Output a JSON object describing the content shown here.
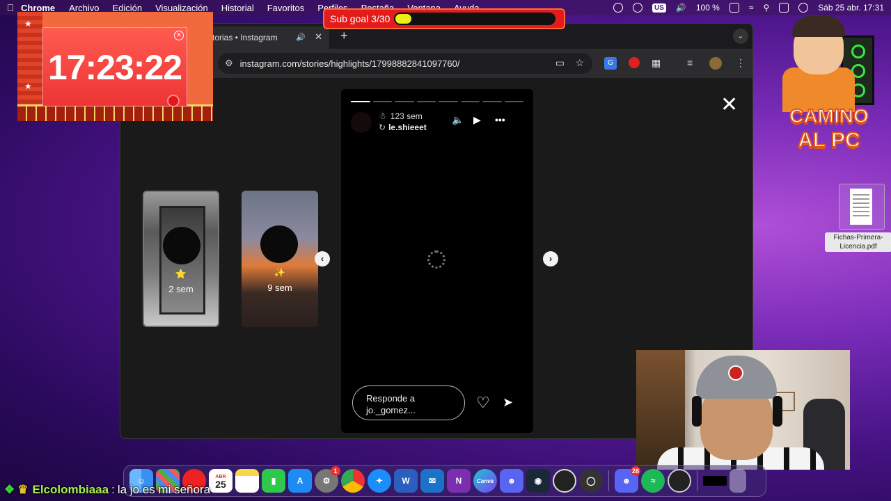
{
  "menubar": {
    "app": "Chrome",
    "items": [
      "Archivo",
      "Edición",
      "Visualización",
      "Historial",
      "Favoritos",
      "Perfiles",
      "Pestaña",
      "Ventana",
      "Ayuda"
    ],
    "us_badge": "US",
    "battery": "100 %",
    "datetime": "Sáb 25 abr.  17:31"
  },
  "sub_goal": {
    "label": "Sub goal 3/30",
    "progress": 0.1
  },
  "browser": {
    "tab_title": "torias • Instagram",
    "url": "instagram.com/stories/highlights/17998882841097760/",
    "extension_gt": "G"
  },
  "story_viewer": {
    "thumbs": [
      {
        "emoji": "⭐",
        "label": "2 sem"
      },
      {
        "emoji": "✨",
        "label": "9 sem"
      }
    ],
    "segments": 8,
    "active_segment": 1,
    "time": "123 sem",
    "username": "le.shieeet",
    "reply_placeholder_line1": "Responde a",
    "reply_placeholder_line2": "jo._gomez..."
  },
  "timer": {
    "value": "17:23:22"
  },
  "logo": {
    "line1": "CAMINO",
    "line2": "AL PC"
  },
  "desktop_file": {
    "name": "Fichas-Primera-Licencia.pdf"
  },
  "dock": {
    "calendar_month": "ABR",
    "calendar_day": "25",
    "settings_badge": "1",
    "discord_badge": "28",
    "word_label": "W",
    "onenote_label": "N",
    "canva_label": "Canva"
  },
  "chat": {
    "username": "Elcolombiaaa",
    "separator": ":",
    "message": "la jo es mi señora"
  },
  "colors": {
    "sub_goal_bg": "#e41b1b",
    "sub_goal_fill": "#e8f015",
    "timer_card": "#ee3535",
    "chat_name": "#a7f04a"
  }
}
